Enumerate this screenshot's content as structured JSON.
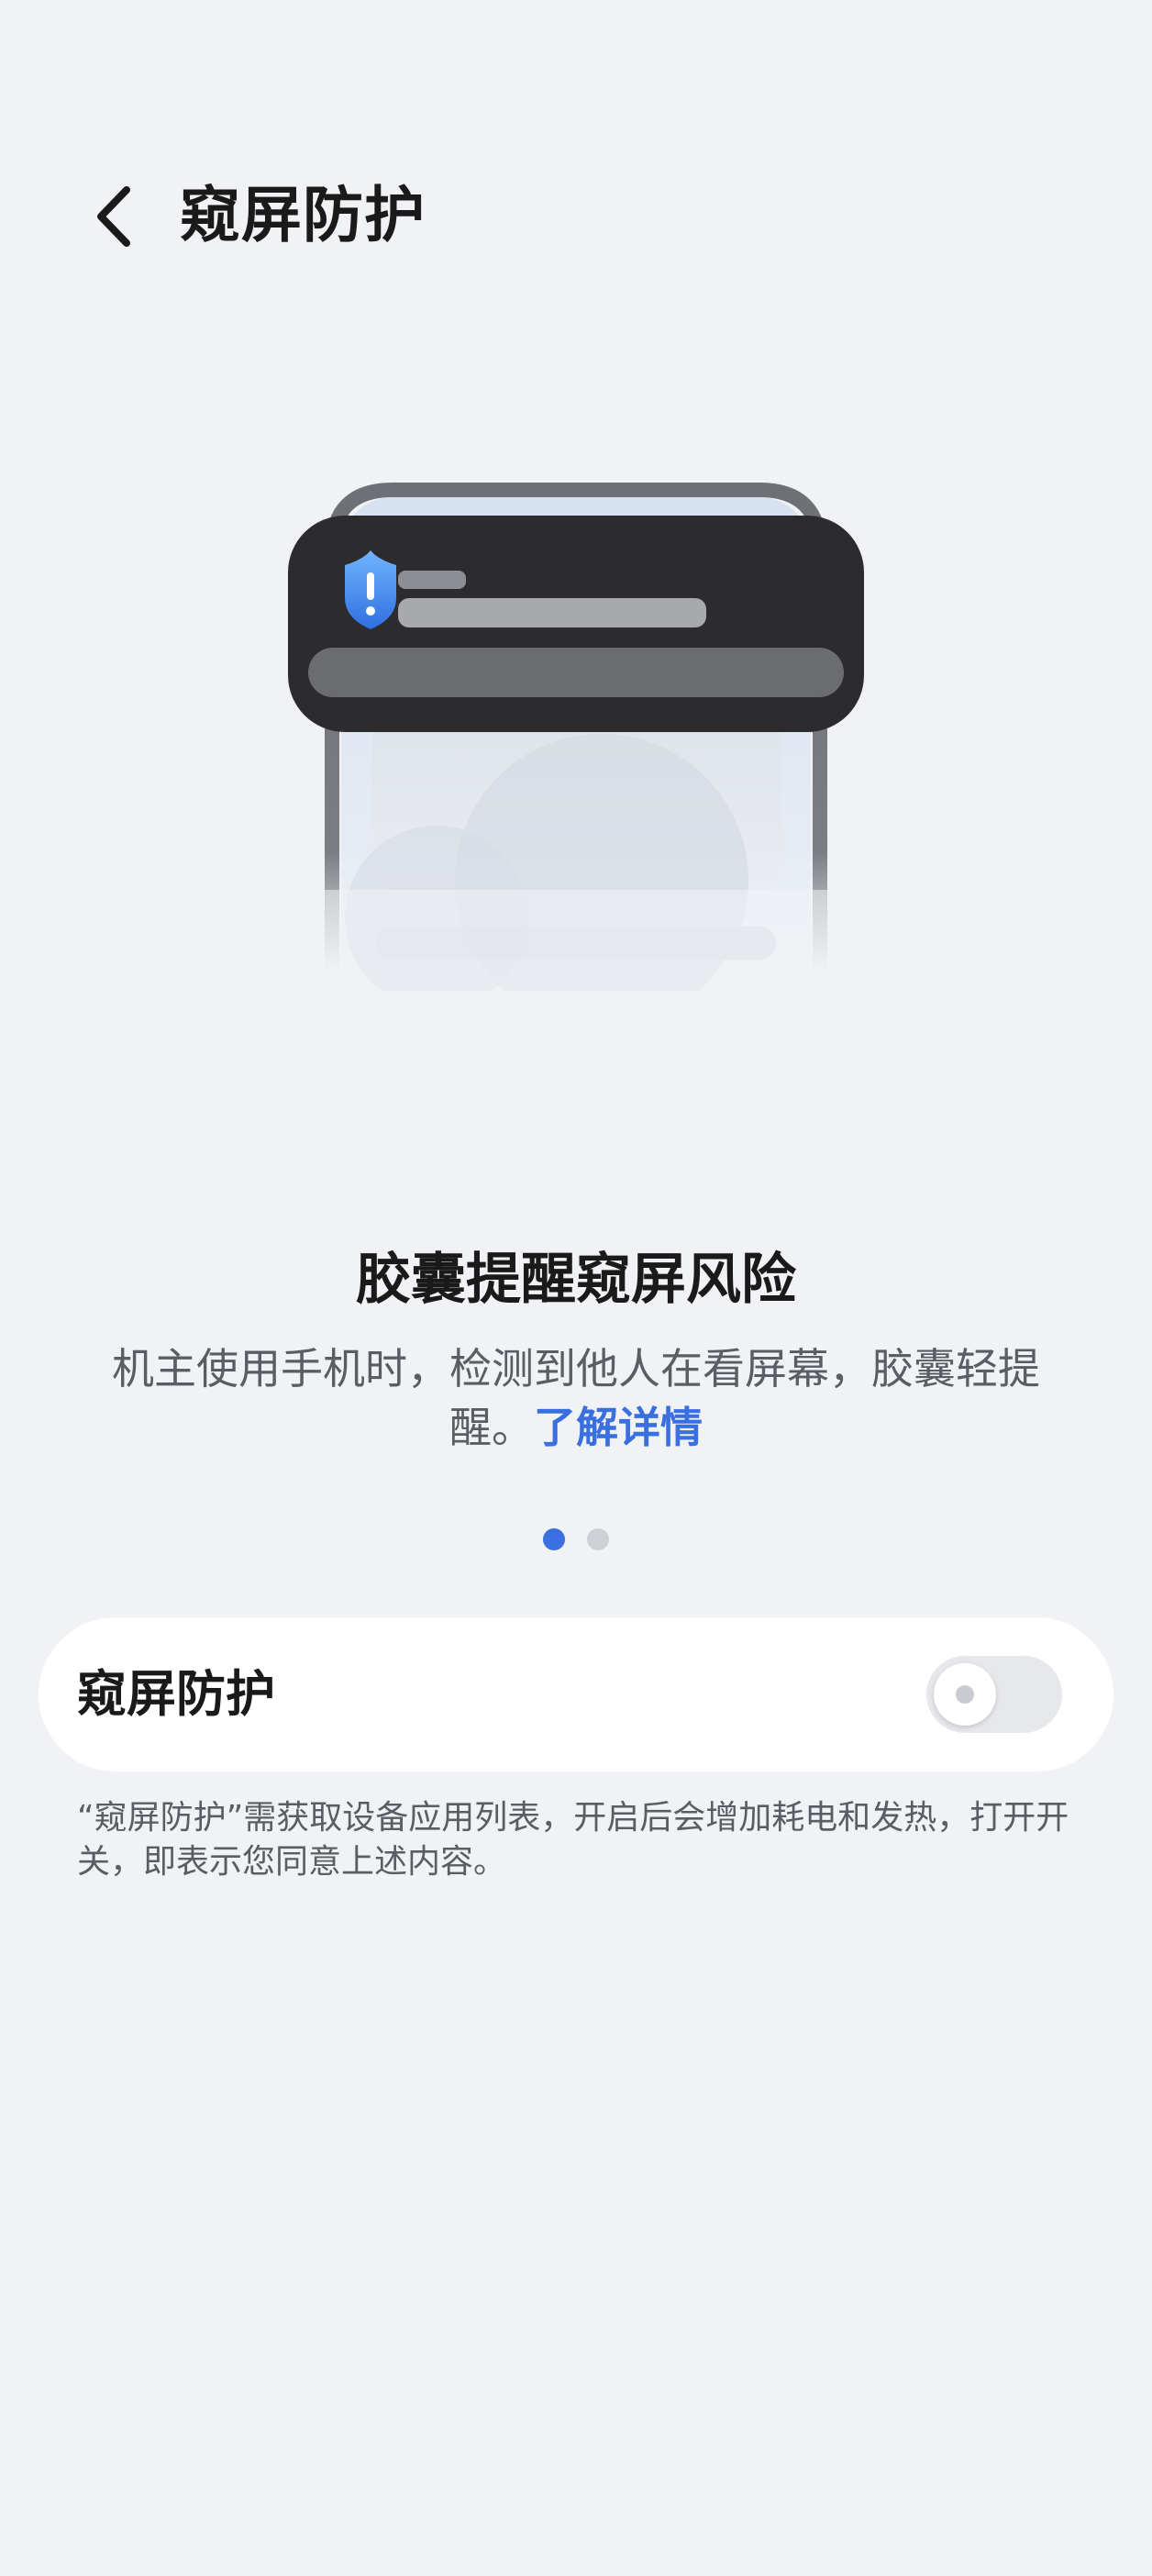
{
  "header": {
    "title": "窥屏防护"
  },
  "feature": {
    "title": "胶囊提醒窥屏风险",
    "description": "机主使用手机时，检测到他人在看屏幕，胶囊轻提醒。",
    "learn_more": "了解详情"
  },
  "pager": {
    "page_count": 2,
    "active_index": 0
  },
  "setting": {
    "label": "窥屏防护",
    "enabled": false
  },
  "note": "“窥屏防护”需获取设备应用列表，开启后会增加耗电和发热，打开开关，即表示您同意上述内容。",
  "icons": {
    "back": "chevron-left-icon",
    "alert": "shield-alert-icon"
  },
  "colors": {
    "accent": "#3a6fe0",
    "background": "#f1f2f5",
    "capsule": "#2c2c2e"
  }
}
